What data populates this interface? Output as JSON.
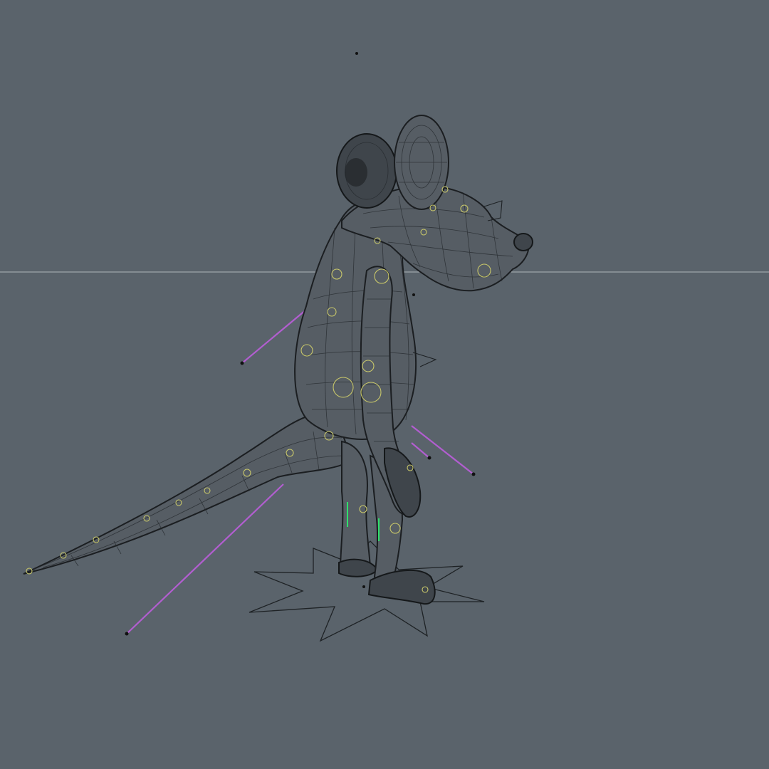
{
  "viewport": {
    "background_color": "#5a636b",
    "mesh_color": "#565d64",
    "wire_color": "#23272b",
    "ik_handle_color": "#b25ed0",
    "control_circle_color": "#c9c86a",
    "foot_control_color": "#2fe06b",
    "horizon_color": "#aeb4b8"
  },
  "scene": {
    "subject": "rigged-mouse-character-wireframe",
    "icons": [
      "rat-model",
      "ik-handle",
      "control-circle",
      "star-floor-control"
    ]
  }
}
